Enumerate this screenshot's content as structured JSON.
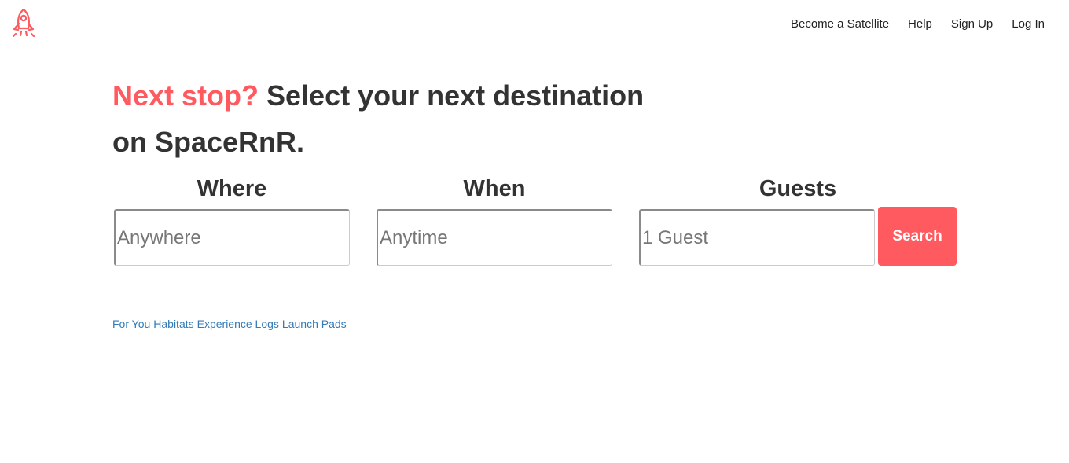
{
  "brand": {
    "logo_icon": "rocket-icon",
    "accent_color": "#ff5a5f"
  },
  "nav": {
    "items": [
      {
        "label": "Become a Satellite"
      },
      {
        "label": "Help"
      },
      {
        "label": "Sign Up"
      },
      {
        "label": "Log In"
      }
    ]
  },
  "hero": {
    "accent": "Next stop?",
    "line1": " Select your next destination",
    "line2": "on SpaceRnR."
  },
  "search": {
    "where": {
      "label": "Where",
      "placeholder": "Anywhere"
    },
    "when": {
      "label": "When",
      "placeholder": "Anytime"
    },
    "guests": {
      "label": "Guests",
      "placeholder": "1 Guest"
    },
    "button_label": "Search"
  },
  "links": {
    "items": [
      {
        "label": "For You"
      },
      {
        "label": "Habitats"
      },
      {
        "label": "Experience Logs"
      },
      {
        "label": "Launch Pads"
      }
    ]
  }
}
